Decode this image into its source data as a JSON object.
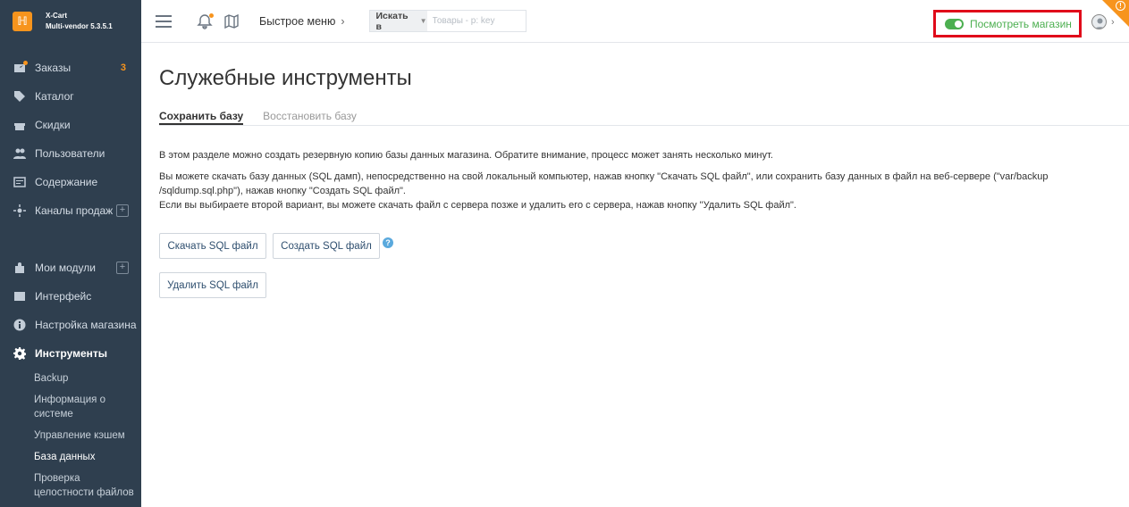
{
  "brand": {
    "line1": "X-Cart",
    "line2": "Multi-vendor 5.3.5.1"
  },
  "sidebar": {
    "items": [
      {
        "label": "Заказы",
        "icon": "orders-icon",
        "badge": "3"
      },
      {
        "label": "Каталог",
        "icon": "tag-icon"
      },
      {
        "label": "Скидки",
        "icon": "gift-icon"
      },
      {
        "label": "Пользователи",
        "icon": "users-icon"
      },
      {
        "label": "Содержание",
        "icon": "content-icon"
      },
      {
        "label": "Каналы продаж",
        "icon": "channels-icon"
      },
      {
        "label": "Мои модули",
        "icon": "puzzle-icon"
      },
      {
        "label": "Интерфейс",
        "icon": "image-icon"
      },
      {
        "label": "Настройка магазина",
        "icon": "info-icon"
      },
      {
        "label": "Инструменты",
        "icon": "gear-icon"
      }
    ],
    "subitems": [
      "Backup",
      "Информация о системе",
      "Управление кэшем",
      "База данных",
      "Проверка целостности файлов"
    ]
  },
  "topbar": {
    "quick_menu": "Быстрое меню",
    "search_scope": "Искать в",
    "search_placeholder": "Товары - р: key",
    "storefront_label": "Посмотреть магазин",
    "corner_icon": "alert-icon"
  },
  "main": {
    "title": "Служебные инструменты",
    "tabs": [
      "Сохранить базу",
      "Восстановить базу"
    ],
    "description": [
      "В этом разделе можно создать резервную копию базы данных магазина. Обратите внимание, процесс может занять несколько минут.",
      "Вы можете скачать базу данных (SQL дамп), непосредственно на свой локальный компьютер, нажав кнопку \"Скачать SQL файл\", или сохранить базу данных в файл на веб-сервере (\"var/backup /sqldump.sql.php\"), нажав кнопку \"Создать SQL файл\".",
      "Если вы выбираете второй вариант, вы можете скачать файл с сервера позже и удалить его с сервера, нажав кнопку \"Удалить SQL файл\"."
    ],
    "buttons": {
      "download": "Скачать SQL файл",
      "create": "Создать SQL файл",
      "delete": "Удалить SQL файл"
    },
    "help_mark": "?"
  },
  "colors": {
    "sidebar_bg": "#2f3f4f",
    "accent_orange": "#f7941d",
    "storefront_green": "#4caf50",
    "highlight_red": "#e00a1a"
  }
}
